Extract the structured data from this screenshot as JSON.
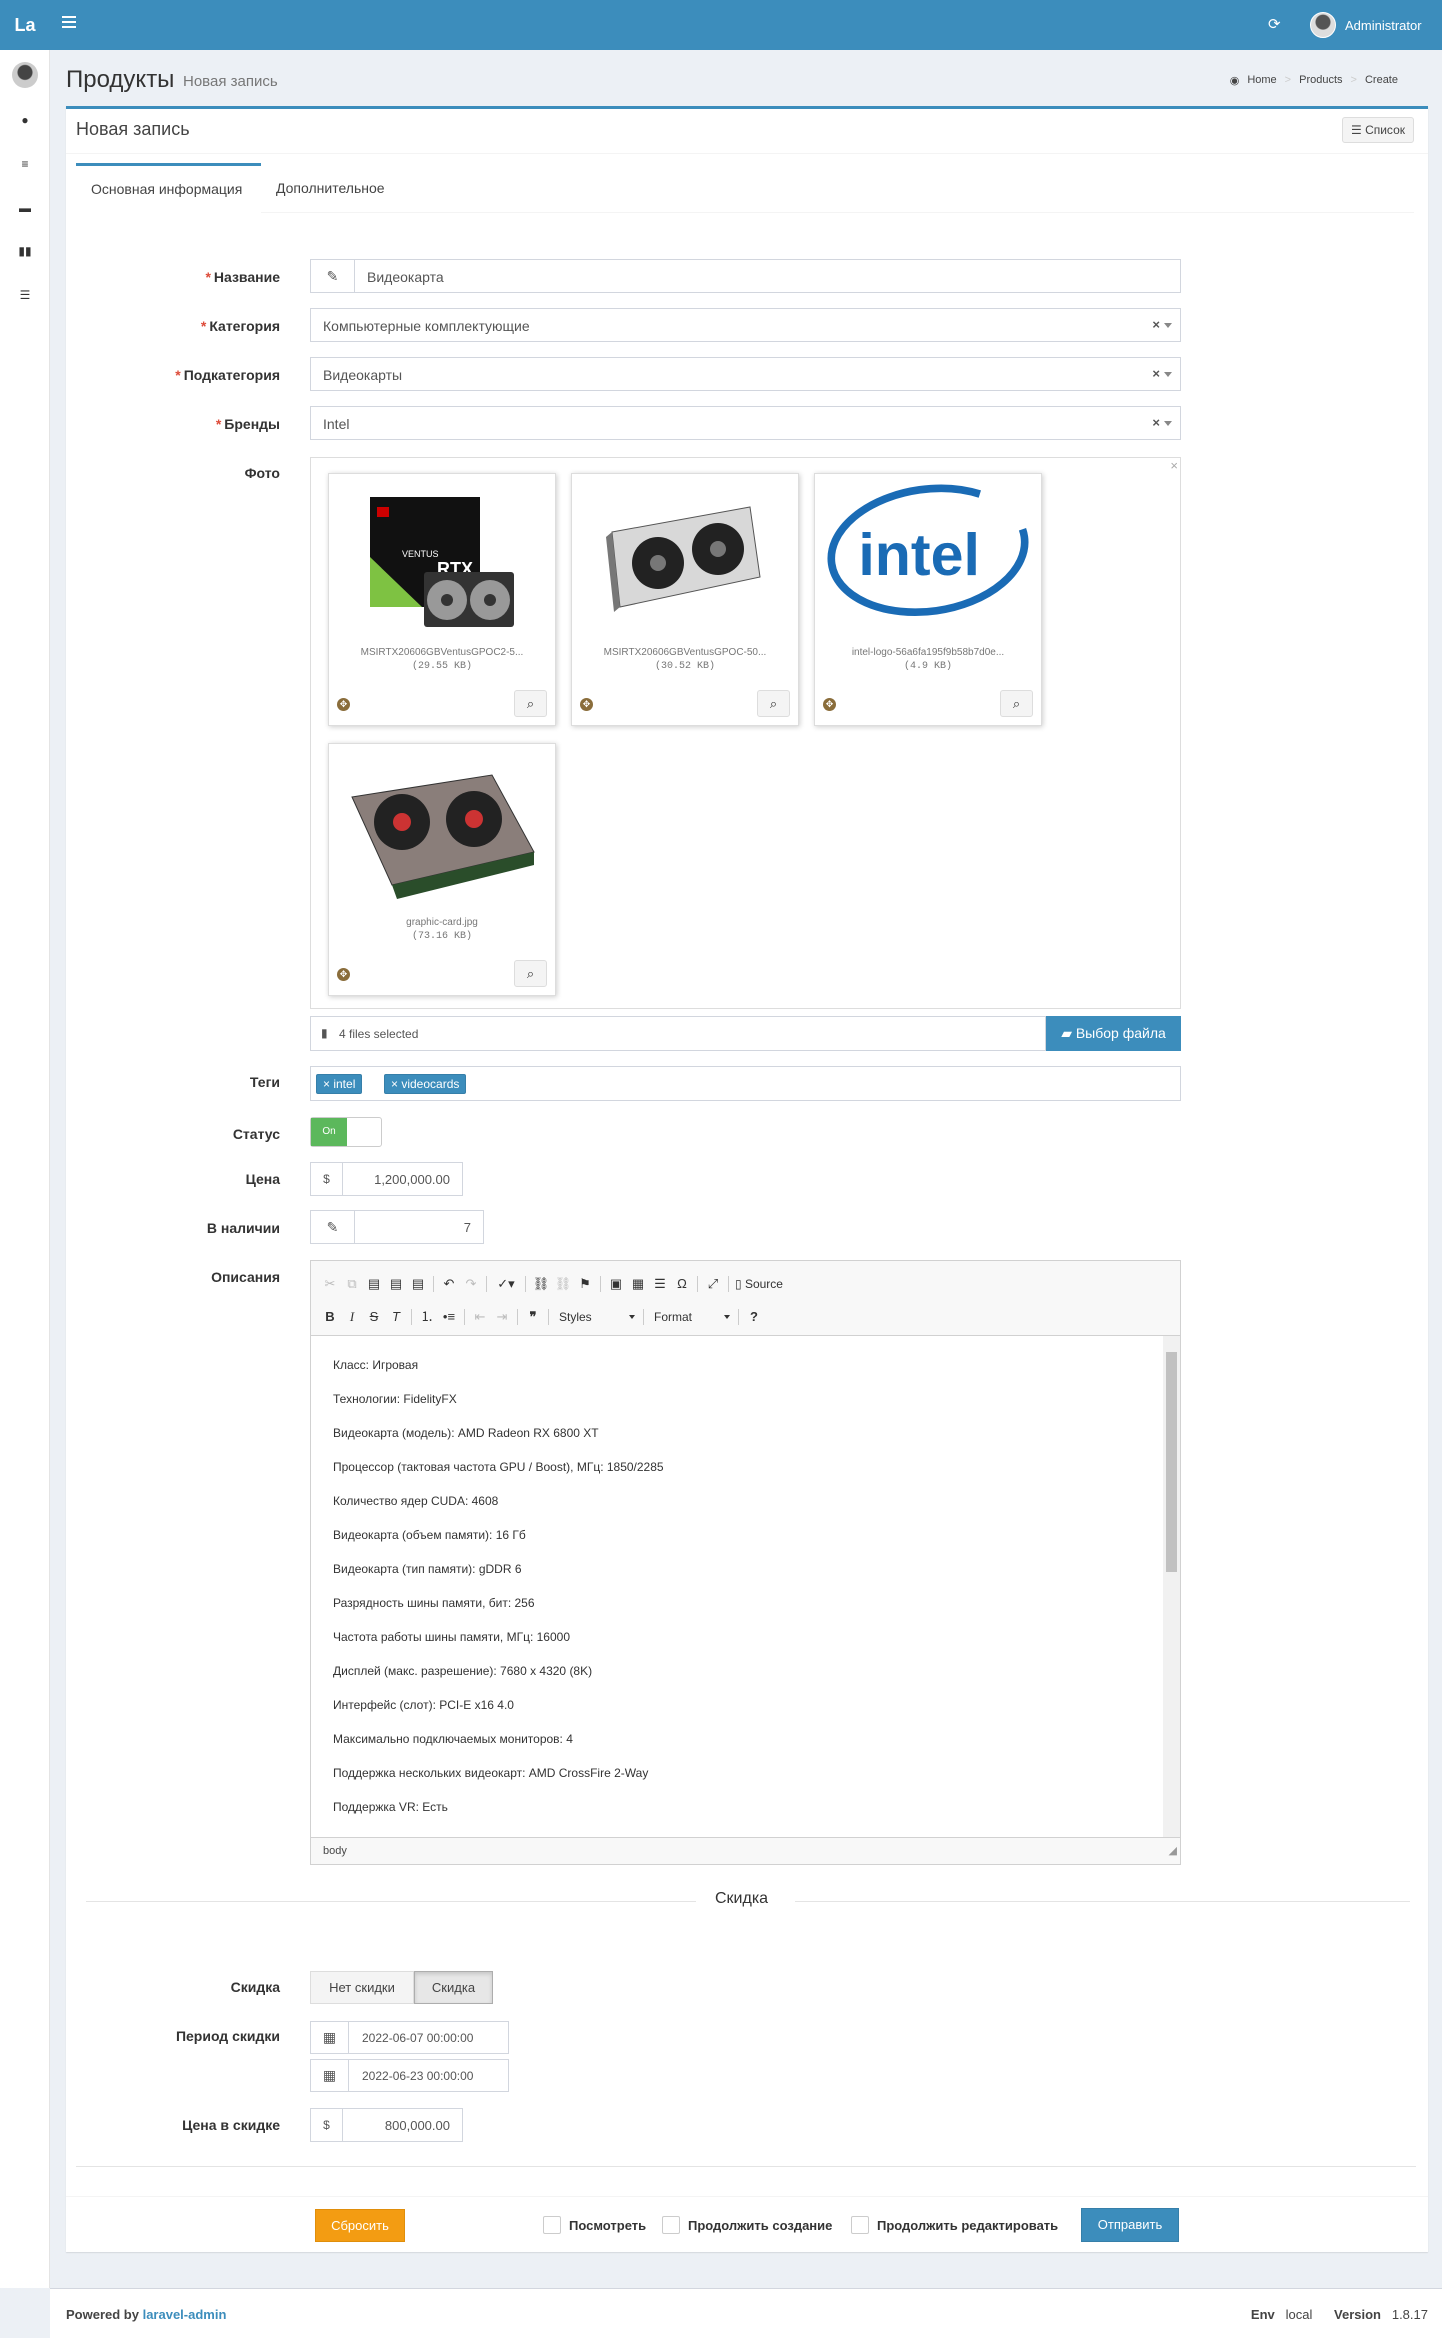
{
  "topbar": {
    "logo": "La",
    "user_name": "Administrator",
    "brand_color": "#3c8dbc"
  },
  "header": {
    "title": "Продукты",
    "subtitle": "Новая запись"
  },
  "breadcrumb": [
    "Home",
    "Products",
    "Create"
  ],
  "box": {
    "title": "Новая запись",
    "list_button": "Список"
  },
  "tabs": [
    {
      "label": "Основная информация",
      "active": true
    },
    {
      "label": "Дополнительное",
      "active": false
    }
  ],
  "form": {
    "name": {
      "label": "Название",
      "value": "Видеокарта"
    },
    "category": {
      "label": "Категория",
      "value": "Компьютерные комплектующие"
    },
    "subcategory": {
      "label": "Подкатегория",
      "value": "Видеокарты"
    },
    "brands": {
      "label": "Бренды",
      "value": "Intel"
    },
    "photo": {
      "label": "Фото",
      "files": [
        {
          "name": "MSIRTX20606GBVentusGPOC2-5...",
          "size": "(29.55 KB)",
          "icon": "msi-rtx-box-image"
        },
        {
          "name": "MSIRTX20606GBVentusGPOC-50...",
          "size": "(30.52 KB)",
          "icon": "msi-graphics-card-image"
        },
        {
          "name": "intel-logo-56a6fa195f9b58b7d0e...",
          "size": "(4.9 KB)",
          "icon": "intel-logo-image"
        },
        {
          "name": "graphic-card.jpg",
          "size": "(73.16 KB)",
          "icon": "graphics-card-image"
        }
      ],
      "caption": "4 files selected",
      "browse_button": "Выбор файла"
    },
    "tags": {
      "label": "Теги",
      "items": [
        "intel",
        "videocards"
      ]
    },
    "status": {
      "label": "Статус",
      "value": "On"
    },
    "price": {
      "label": "Цена",
      "prefix": "$",
      "value": "1,200,000.00"
    },
    "stock": {
      "label": "В наличии",
      "value": "7"
    },
    "description": {
      "label": "Описания",
      "toolbar_source": "Source",
      "toolbar_styles": "Styles",
      "toolbar_format": "Format",
      "lines": [
        "Класс: Игровая",
        "Технологии: FidelityFX",
        "Видеокарта (модель): AMD Radeon RX 6800 XT",
        "Процессор (тактовая частота GPU / Boost), МГц: 1850/2285",
        "Количество ядер CUDA: 4608",
        "Видеокарта (объем памяти): 16 Гб",
        "Видеокарта (тип памяти): gDDR 6",
        "Разрядность шины памяти, бит: 256",
        "Частота работы шины памяти, МГц: 16000",
        "Дисплей (макс. разрешение): 7680 x 4320 (8K)",
        "Интерфейс (слот): PCI-E x16 4.0",
        "Максимально подключаемых мониторов: 4",
        "Поддержка нескольких видеокарт: AMD CrossFire 2-Way",
        "Поддержка VR: Есть"
      ],
      "footer_path": "body"
    }
  },
  "discount": {
    "section_title": "Скидка",
    "type": {
      "label": "Скидка",
      "options": [
        "Нет скидки",
        "Скидка"
      ],
      "selected": "Скидка"
    },
    "period": {
      "label": "Период скидки",
      "start": "2022-06-07 00:00:00",
      "end": "2022-06-23 00:00:00"
    },
    "price": {
      "label": "Цена в скидке",
      "prefix": "$",
      "value": "800,000.00"
    }
  },
  "actions": {
    "reset": "Сбросить",
    "view": "Посмотреть",
    "continue_create": "Продолжить создание",
    "continue_edit": "Продолжить редактировать",
    "submit": "Отправить"
  },
  "footer": {
    "powered_prefix": "Powered by",
    "powered_link": "laravel-admin",
    "env_label": "Env",
    "env_value": "local",
    "version_label": "Version",
    "version_value": "1.8.17"
  }
}
